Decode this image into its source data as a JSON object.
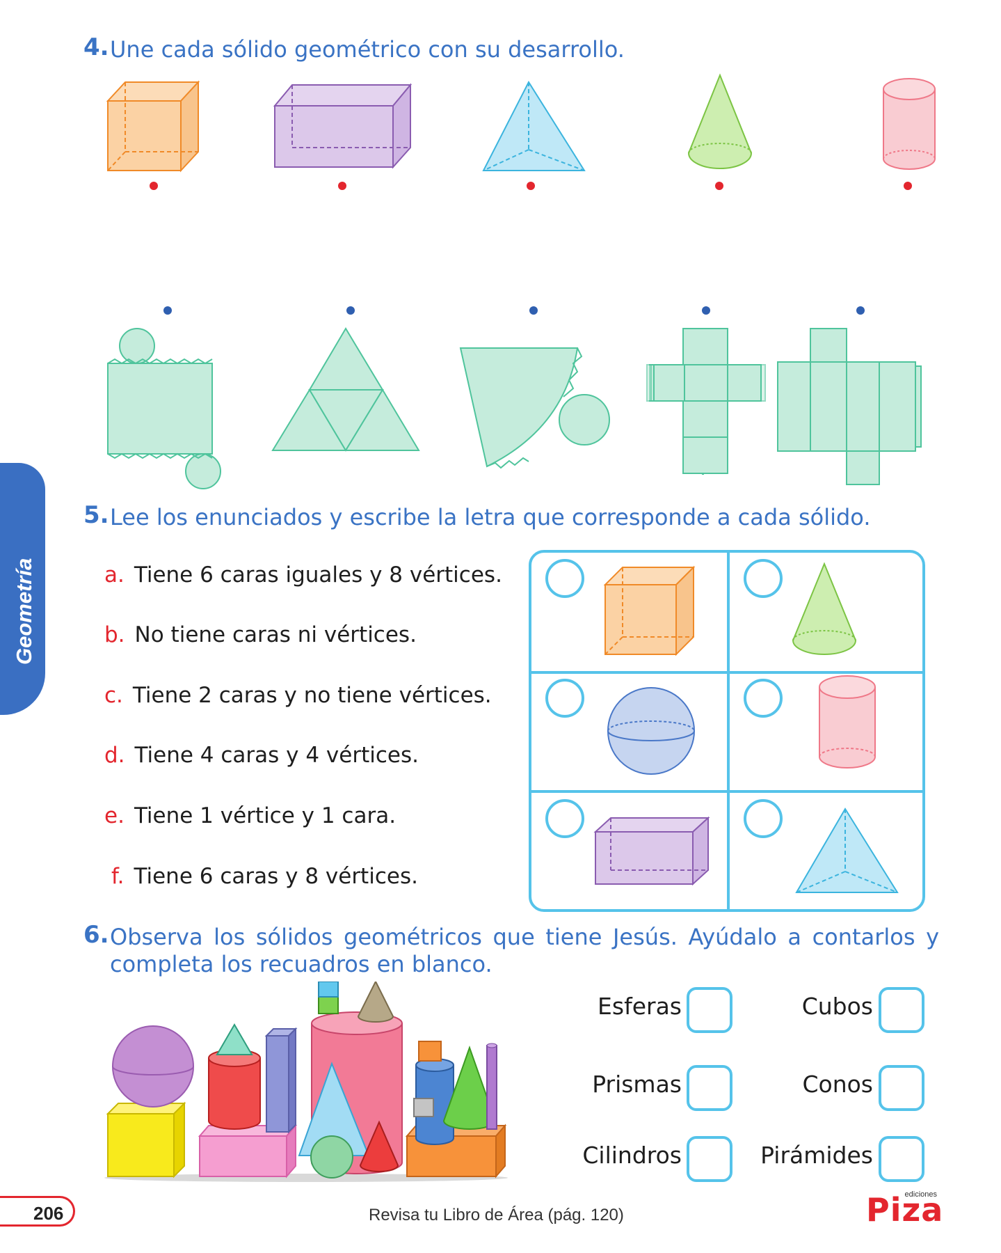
{
  "exercise4": {
    "number": "4.",
    "instruction": "Une cada sólido geométrico con su desarrollo."
  },
  "exercise5": {
    "number": "5.",
    "instruction": "Lee los enunciados y escribe la letra que corresponde a cada sólido.",
    "statements": [
      {
        "letter": "a.",
        "text": "Tiene 6 caras iguales y 8 vértices."
      },
      {
        "letter": "b.",
        "text": "No tiene caras ni vértices."
      },
      {
        "letter": "c.",
        "text": "Tiene 2 caras y no tiene vértices."
      },
      {
        "letter": "d.",
        "text": "Tiene 4 caras y 4 vértices."
      },
      {
        "letter": "e.",
        "text": "Tiene 1 vértice y 1 cara."
      },
      {
        "letter": "f.",
        "text": "Tiene 6 caras y 8 vértices."
      }
    ]
  },
  "exercise6": {
    "number": "6.",
    "instruction_line1": "Observa los sólidos geométricos que tiene Jesús. Ayúdalo a contarlos y",
    "instruction_line2": "completa los recuadros en blanco.",
    "labels": {
      "esferas": "Esferas",
      "cubos": "Cubos",
      "prismas": "Prismas",
      "conos": "Conos",
      "cilindros": "Cilindros",
      "piramides": "Pirámides"
    }
  },
  "side_tab": "Geometría",
  "page_number": "206",
  "footer_text": "Revisa tu Libro de Área (pág. 120)",
  "logo": {
    "main": "Piza",
    "small": "ediciones"
  },
  "colors": {
    "accent_blue": "#3a73c4",
    "accent_red": "#e3262e",
    "box_cyan": "#55c3ea",
    "net_green": "#c5ecdc"
  }
}
